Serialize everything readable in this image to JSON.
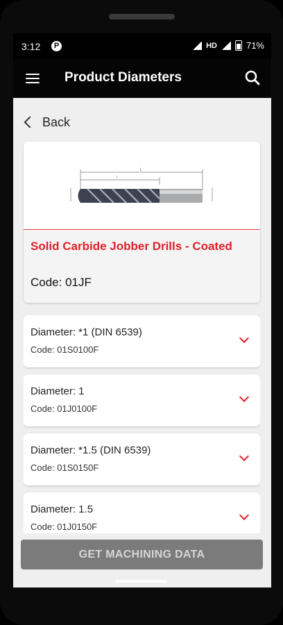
{
  "status_bar": {
    "time": "3:12",
    "notification_glyph": "P",
    "network": "HD",
    "battery": "71%"
  },
  "app_bar": {
    "title": "Product Diameters",
    "menu_icon": "hamburger-menu-icon",
    "search_icon": "search-icon"
  },
  "back": {
    "label": "Back"
  },
  "product": {
    "name": "Solid Carbide Jobber Drills - Coated",
    "code": "Code: 01JF",
    "image_icon": "drill-diagram"
  },
  "diameters": [
    {
      "diameter": "Diameter: *1 (DIN 6539)",
      "code": "Code: 01S0100F"
    },
    {
      "diameter": "Diameter: 1",
      "code": "Code: 01J0100F"
    },
    {
      "diameter": "Diameter: *1.5 (DIN 6539)",
      "code": "Code: 01S0150F"
    },
    {
      "diameter": "Diameter: 1.5",
      "code": "Code: 01J0150F"
    }
  ],
  "cta": {
    "label": "GET MACHINING DATA"
  },
  "colors": {
    "accent": "#e2202a",
    "appbar": "#050505",
    "background": "#efefef",
    "cta_disabled": "#7b7b7b"
  }
}
